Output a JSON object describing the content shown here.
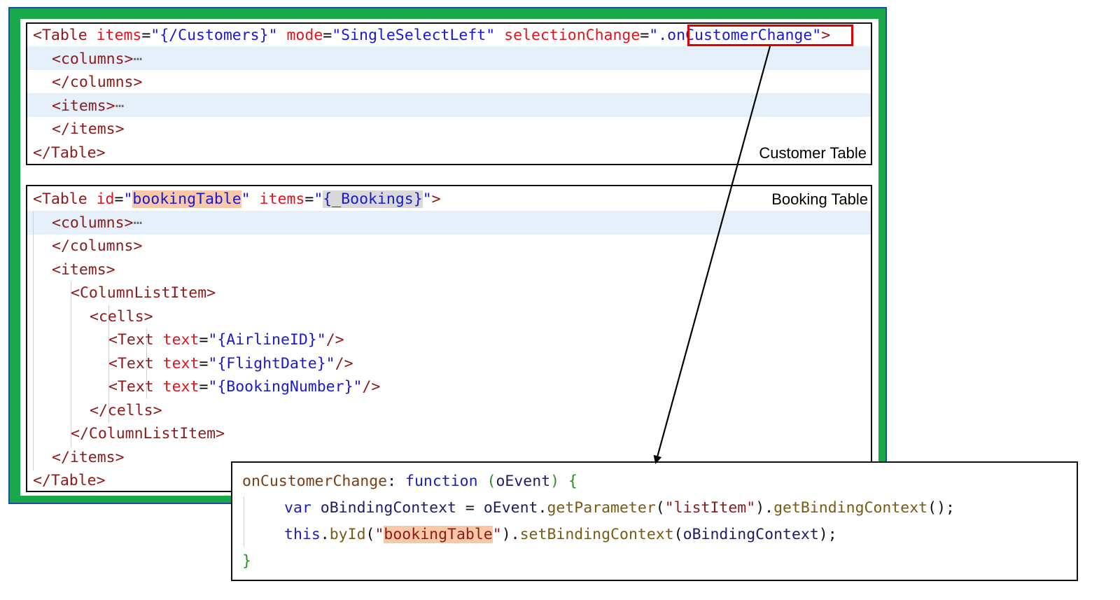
{
  "customer_table": {
    "caption": "Customer Table",
    "lines": [
      {
        "indent": 0,
        "html_tokens": [
          {
            "c": "tag",
            "t": "<Table "
          },
          {
            "c": "attr",
            "t": "items"
          },
          {
            "c": "eq",
            "t": "="
          },
          {
            "c": "str",
            "t": "\"{/Customers}\""
          },
          {
            "c": "eq",
            "t": " "
          },
          {
            "c": "attr",
            "t": "mode"
          },
          {
            "c": "eq",
            "t": "="
          },
          {
            "c": "str",
            "t": "\"SingleSelectLeft\""
          },
          {
            "c": "eq",
            "t": " "
          },
          {
            "c": "attr",
            "t": "selectionChange"
          },
          {
            "c": "eq",
            "t": "="
          },
          {
            "c": "str",
            "t": "\".onCustomerChange\""
          },
          {
            "c": "tag",
            "t": ">"
          }
        ]
      },
      {
        "indent": 2,
        "html_tokens": [
          {
            "c": "tag",
            "t": "<columns>"
          },
          {
            "c": "dots",
            "t": "⋯"
          }
        ]
      },
      {
        "indent": 2,
        "html_tokens": [
          {
            "c": "tag",
            "t": "</columns>"
          }
        ]
      },
      {
        "indent": 2,
        "html_tokens": [
          {
            "c": "tag",
            "t": "<items>"
          },
          {
            "c": "dots",
            "t": "⋯"
          }
        ]
      },
      {
        "indent": 2,
        "html_tokens": [
          {
            "c": "tag",
            "t": "</items>"
          }
        ]
      },
      {
        "indent": 0,
        "html_tokens": [
          {
            "c": "tag",
            "t": "</Table>"
          }
        ]
      }
    ]
  },
  "booking_table": {
    "caption": "Booking Table",
    "lines": [
      {
        "indent": 0,
        "html_tokens": [
          {
            "c": "tag",
            "t": "<Table "
          },
          {
            "c": "attr",
            "t": "id"
          },
          {
            "c": "eq",
            "t": "="
          },
          {
            "c": "str",
            "t": "\""
          },
          {
            "c": "str mark",
            "t": "bookingTable"
          },
          {
            "c": "str",
            "t": "\""
          },
          {
            "c": "eq",
            "t": " "
          },
          {
            "c": "attr",
            "t": "items"
          },
          {
            "c": "eq",
            "t": "="
          },
          {
            "c": "str",
            "t": "\""
          },
          {
            "c": "str markgray",
            "t": "{_Bookings}"
          },
          {
            "c": "str",
            "t": "\""
          },
          {
            "c": "tag",
            "t": ">"
          }
        ]
      },
      {
        "indent": 2,
        "html_tokens": [
          {
            "c": "tag",
            "t": "<columns>"
          },
          {
            "c": "dots",
            "t": "⋯"
          }
        ]
      },
      {
        "indent": 2,
        "html_tokens": [
          {
            "c": "tag",
            "t": "</columns>"
          }
        ]
      },
      {
        "indent": 2,
        "html_tokens": [
          {
            "c": "tag",
            "t": "<items>"
          }
        ]
      },
      {
        "indent": 4,
        "html_tokens": [
          {
            "c": "tag",
            "t": "<ColumnListItem>"
          }
        ]
      },
      {
        "indent": 6,
        "html_tokens": [
          {
            "c": "tag",
            "t": "<cells>"
          }
        ]
      },
      {
        "indent": 8,
        "html_tokens": [
          {
            "c": "tag",
            "t": "<Text "
          },
          {
            "c": "attr",
            "t": "text"
          },
          {
            "c": "eq",
            "t": "="
          },
          {
            "c": "str",
            "t": "\"{AirlineID}\""
          },
          {
            "c": "tag",
            "t": "/>"
          }
        ]
      },
      {
        "indent": 8,
        "html_tokens": [
          {
            "c": "tag",
            "t": "<Text "
          },
          {
            "c": "attr",
            "t": "text"
          },
          {
            "c": "eq",
            "t": "="
          },
          {
            "c": "str",
            "t": "\"{FlightDate}\""
          },
          {
            "c": "tag",
            "t": "/>"
          }
        ]
      },
      {
        "indent": 8,
        "html_tokens": [
          {
            "c": "tag",
            "t": "<Text "
          },
          {
            "c": "attr",
            "t": "text"
          },
          {
            "c": "eq",
            "t": "="
          },
          {
            "c": "str",
            "t": "\"{BookingNumber}\""
          },
          {
            "c": "tag",
            "t": "/>"
          }
        ]
      },
      {
        "indent": 6,
        "html_tokens": [
          {
            "c": "tag",
            "t": "</cells>"
          }
        ]
      },
      {
        "indent": 4,
        "html_tokens": [
          {
            "c": "tag",
            "t": "</ColumnListItem>"
          }
        ]
      },
      {
        "indent": 2,
        "html_tokens": [
          {
            "c": "tag",
            "t": "</items>"
          }
        ]
      },
      {
        "indent": 0,
        "html_tokens": [
          {
            "c": "tag",
            "t": "</Table>"
          }
        ]
      }
    ]
  },
  "controller_code": {
    "lines": [
      {
        "indent": 0,
        "tokens": [
          {
            "c": "js-fn",
            "t": "onCustomerChange"
          },
          {
            "c": "js-p",
            "t": ": "
          },
          {
            "c": "js-kw",
            "t": "function"
          },
          {
            "c": "js-p",
            "t": " "
          },
          {
            "c": "js-br",
            "t": "("
          },
          {
            "c": "js-id",
            "t": "oEvent"
          },
          {
            "c": "js-br",
            "t": ")"
          },
          {
            "c": "js-p",
            "t": " "
          },
          {
            "c": "js-br",
            "t": "{"
          }
        ]
      },
      {
        "indent": 4,
        "tokens": [
          {
            "c": "js-kw",
            "t": "var"
          },
          {
            "c": "js-p",
            "t": " "
          },
          {
            "c": "js-id",
            "t": "oBindingContext"
          },
          {
            "c": "js-p",
            "t": " = "
          },
          {
            "c": "js-id",
            "t": "oEvent"
          },
          {
            "c": "js-p",
            "t": "."
          },
          {
            "c": "js-m",
            "t": "getParameter"
          },
          {
            "c": "js-p",
            "t": "("
          },
          {
            "c": "js-str",
            "t": "\"listItem\""
          },
          {
            "c": "js-p",
            "t": ")."
          },
          {
            "c": "js-m",
            "t": "getBindingContext"
          },
          {
            "c": "js-p",
            "t": "();"
          }
        ]
      },
      {
        "indent": 4,
        "tokens": [
          {
            "c": "js-kw",
            "t": "this"
          },
          {
            "c": "js-p",
            "t": "."
          },
          {
            "c": "js-m",
            "t": "byId"
          },
          {
            "c": "js-p",
            "t": "("
          },
          {
            "c": "js-str",
            "t": "\""
          },
          {
            "c": "js-str mark",
            "t": "bookingTable"
          },
          {
            "c": "js-str",
            "t": "\""
          },
          {
            "c": "js-p",
            "t": ")."
          },
          {
            "c": "js-m",
            "t": "setBindingContext"
          },
          {
            "c": "js-p",
            "t": "("
          },
          {
            "c": "js-id",
            "t": "oBindingContext"
          },
          {
            "c": "js-p",
            "t": ");"
          }
        ]
      },
      {
        "indent": 0,
        "tokens": [
          {
            "c": "js-br",
            "t": "}"
          }
        ]
      }
    ]
  },
  "colors": {
    "frame_green": "#18a94b",
    "frame_blue": "#1f4aa8",
    "highlight_box": "#e00000"
  }
}
